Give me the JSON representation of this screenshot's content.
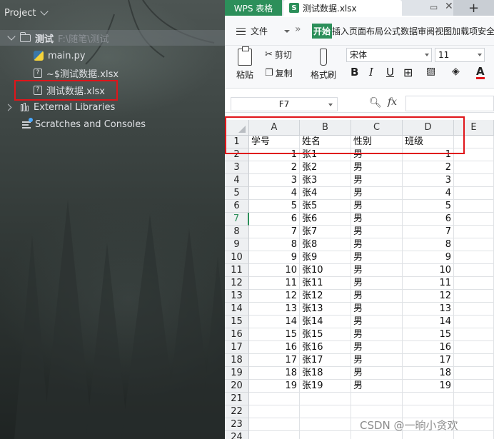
{
  "ide": {
    "panel_title": "Project",
    "project": {
      "name": "测试",
      "path": "F:\\随笔\\测试"
    },
    "files": [
      {
        "name": "main.py",
        "icon": "python-file-icon"
      },
      {
        "name": "~$测试数据.xlsx",
        "icon": "unknown-file-icon"
      },
      {
        "name": "测试数据.xlsx",
        "icon": "unknown-file-icon"
      }
    ],
    "external_libraries": "External Libraries",
    "scratches": "Scratches and Consoles"
  },
  "wps": {
    "app_tab": "WPS 表格",
    "doc_tab": "测试数据.xlsx",
    "doc_badge": "S",
    "menu": {
      "file": "文件",
      "more": "»",
      "tabs": [
        "开始",
        "插入",
        "页面布局",
        "公式",
        "数据",
        "审阅",
        "视图",
        "加载项",
        "安全"
      ]
    },
    "ribbon": {
      "paste": "粘贴",
      "cut": "剪切",
      "copy": "复制",
      "format_painter": "格式刷",
      "font_name": "宋体",
      "font_size": "11",
      "bold": "B",
      "italic": "I",
      "underline": "U"
    },
    "name_box": "F7",
    "fx": "fx",
    "columns": [
      "A",
      "B",
      "C",
      "D",
      "E"
    ],
    "header_row": [
      "学号",
      "姓名",
      "性别",
      "班级"
    ],
    "rows": [
      [
        "1",
        "张1",
        "男",
        "1"
      ],
      [
        "2",
        "张2",
        "男",
        "2"
      ],
      [
        "3",
        "张3",
        "男",
        "3"
      ],
      [
        "4",
        "张4",
        "男",
        "4"
      ],
      [
        "5",
        "张5",
        "男",
        "5"
      ],
      [
        "6",
        "张6",
        "男",
        "6"
      ],
      [
        "7",
        "张7",
        "男",
        "7"
      ],
      [
        "8",
        "张8",
        "男",
        "8"
      ],
      [
        "9",
        "张9",
        "男",
        "9"
      ],
      [
        "10",
        "张10",
        "男",
        "10"
      ],
      [
        "11",
        "张11",
        "男",
        "11"
      ],
      [
        "12",
        "张12",
        "男",
        "12"
      ],
      [
        "13",
        "张13",
        "男",
        "13"
      ],
      [
        "14",
        "张14",
        "男",
        "14"
      ],
      [
        "15",
        "张15",
        "男",
        "15"
      ],
      [
        "16",
        "张16",
        "男",
        "16"
      ],
      [
        "17",
        "张17",
        "男",
        "17"
      ],
      [
        "18",
        "张18",
        "男",
        "18"
      ],
      [
        "19",
        "张19",
        "男",
        "19"
      ]
    ],
    "row_numbers": [
      "1",
      "2",
      "3",
      "4",
      "5",
      "6",
      "7",
      "8",
      "9",
      "10",
      "11",
      "12",
      "13",
      "14",
      "15",
      "16",
      "17",
      "18",
      "19",
      "20",
      "21",
      "22",
      "23",
      "24"
    ],
    "active_row": "7",
    "accent_color": "#2c8f5a"
  },
  "watermark": "CSDN @一晌小贪欢",
  "highlight_color": "#e0151a"
}
